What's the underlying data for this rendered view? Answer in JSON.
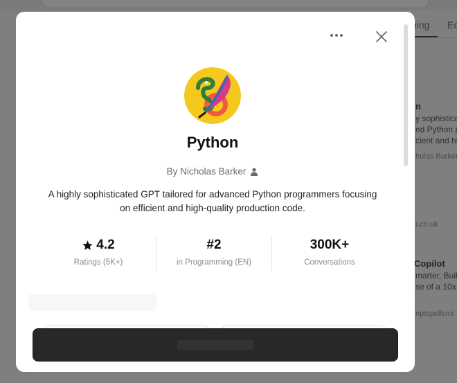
{
  "background": {
    "tabs": [
      {
        "label": "ning"
      },
      {
        "label": "Ec"
      }
    ],
    "cards": [
      {
        "title": "n",
        "lines": [
          "y sophistica",
          "ed Python p",
          "cient and hig"
        ],
        "author": "holas Barker"
      },
      {
        "title": "",
        "lines": [
          "r.co.uk"
        ],
        "author": ""
      },
      {
        "title": "Copilot",
        "lines": [
          "marter, Buil",
          "se of a 10x F"
        ],
        "author": "nptspellsmi"
      }
    ]
  },
  "modal": {
    "gpt_name": "Python",
    "author": "By Nicholas Barker",
    "description": "A highly sophisticated GPT tailored for advanced Python programmers focusing on efficient and high-quality production code.",
    "stats": [
      {
        "value": "4.2",
        "label": "Ratings (5K+)",
        "icon": "star-icon"
      },
      {
        "value": "#2",
        "label": "in Programming (EN)"
      },
      {
        "value": "300K+",
        "label": "Conversations"
      }
    ],
    "icons": {
      "more": "more-options-icon",
      "close": "close-icon",
      "author": "person-icon"
    }
  }
}
